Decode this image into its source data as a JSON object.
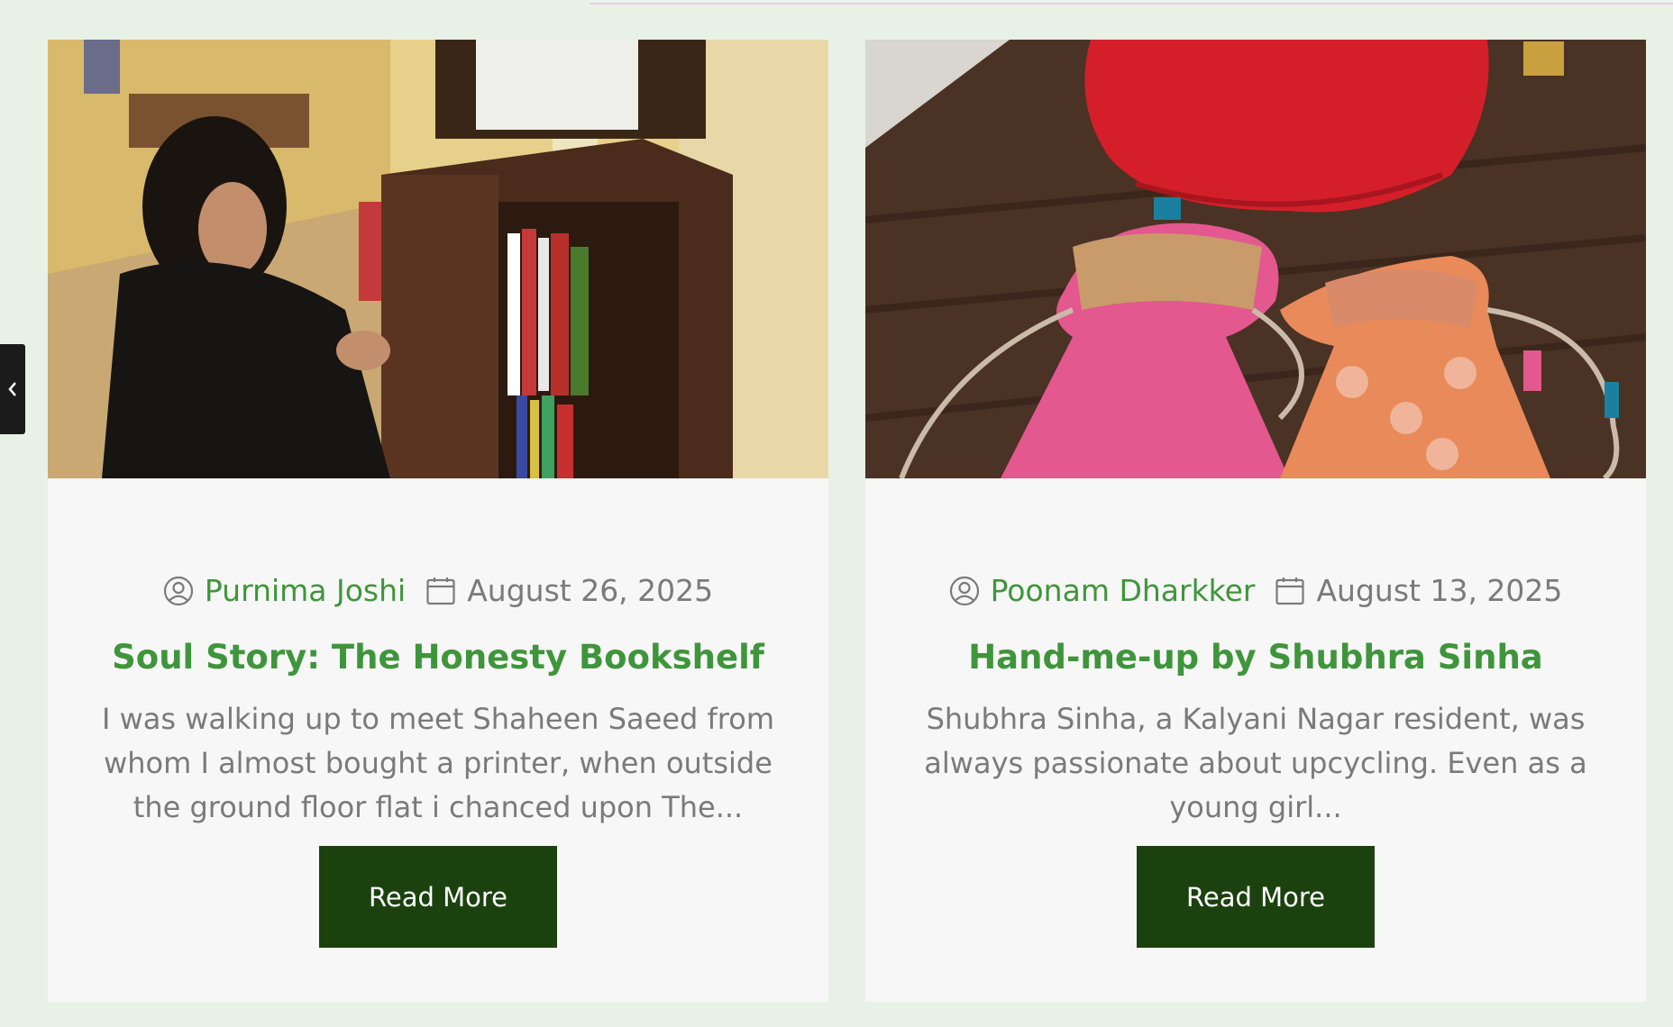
{
  "posts": [
    {
      "author": "Purnima Joshi",
      "date": "August 26, 2025",
      "title": "Soul Story: The Honesty Bookshelf",
      "excerpt": "I was walking up to meet Shaheen Saeed from whom I almost bought a printer, when outside the ground floor flat i chanced upon The...",
      "button": "Read More"
    },
    {
      "author": "Poonam Dharkker",
      "date": "August 13, 2025",
      "title": "Hand-me-up by Shubhra Sinha",
      "excerpt": "Shubhra Sinha, a Kalyani Nagar resident, was always passionate about upcycling. Even as a young girl...",
      "button": "Read More"
    }
  ],
  "colors": {
    "page_bg": "#e8f1e5",
    "card_bg": "#f7f7f7",
    "accent_green": "#3f953b",
    "button_bg": "#1b420e",
    "meta_gray": "#7a7a7a"
  },
  "icons": {
    "side_tab": "chevron-left-icon",
    "author": "user-circle-icon",
    "date": "calendar-icon"
  }
}
